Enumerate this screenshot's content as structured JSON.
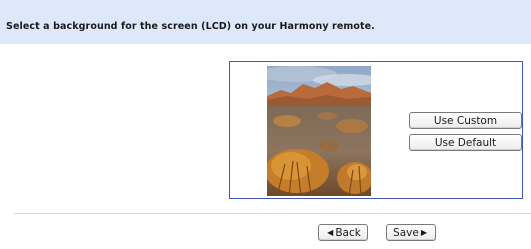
{
  "header": {
    "instruction": "Select a background for the screen (LCD) on your Harmony remote."
  },
  "preview": {
    "image": "desert-sunset-landscape"
  },
  "buttons": {
    "use_custom": "Use Custom",
    "use_default": "Use Default",
    "back": "Back",
    "save": "Save",
    "back_icon": "chevron-left-icon",
    "save_icon": "chevron-right-icon"
  },
  "colors": {
    "header_bg": "#dde9fb",
    "panel_border": "#4056b8"
  }
}
